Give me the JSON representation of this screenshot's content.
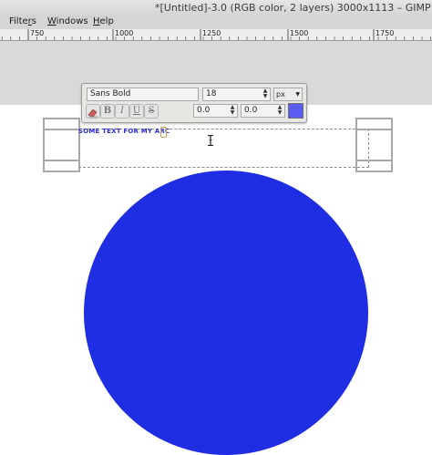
{
  "window": {
    "title": "*[Untitled]-3.0 (RGB color, 2 layers) 3000x1113 – GIMP"
  },
  "menubar": {
    "items": [
      {
        "label": "Filters",
        "mnemonic": "r"
      },
      {
        "label": "Windows",
        "mnemonic": "W"
      },
      {
        "label": "Help",
        "mnemonic": "H"
      }
    ]
  },
  "ruler": {
    "labels": [
      "750",
      "1000",
      "1250",
      "1500",
      "1750"
    ]
  },
  "text_toolbar": {
    "font": "Sans Bold",
    "size": "18",
    "unit": "px",
    "indent": "0.0",
    "line_spacing": "0.0",
    "text_color": "#5a5df0",
    "style_buttons": [
      "clear-style",
      "bold",
      "italic",
      "underline",
      "strikethrough"
    ]
  },
  "canvas": {
    "text": "SOME TEXT FOR MY ARC",
    "text_color": "#2a2ad8",
    "circle_color": "#1f2ee3"
  }
}
